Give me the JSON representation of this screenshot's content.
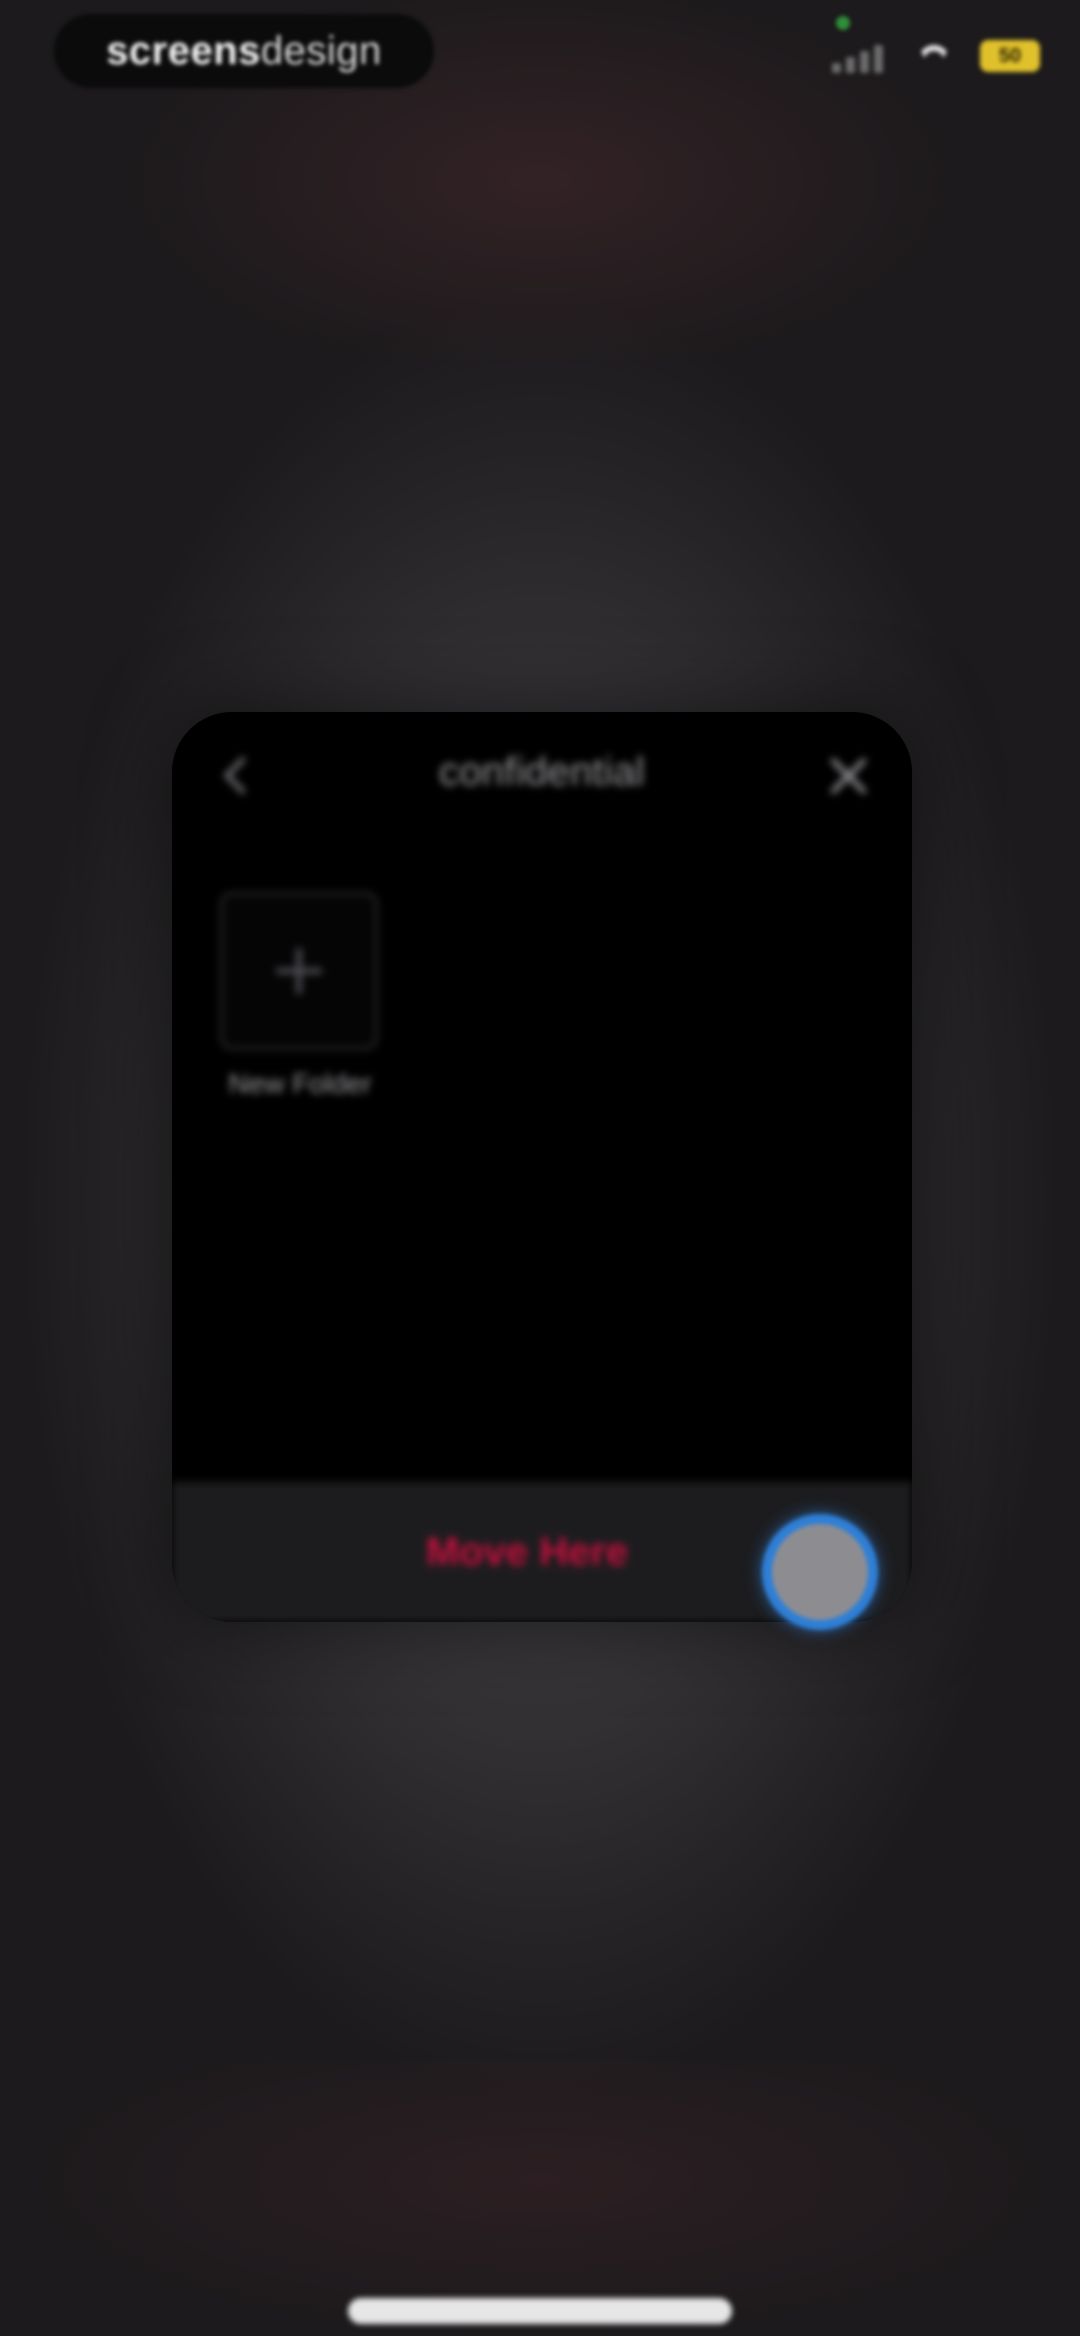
{
  "status_bar": {
    "watermark_bold": "screens",
    "watermark_light": "design",
    "battery_level": "50"
  },
  "dialog": {
    "title": "confidential",
    "new_folder_label": "New Folder",
    "move_here_label": "Move Here"
  },
  "icons": {
    "back": "chevron-left-icon",
    "close": "close-icon",
    "new_folder": "plus-icon"
  },
  "colors": {
    "accent_red": "#c4103e",
    "touch_ring": "#2f7fd6",
    "battery": "#e0c12c"
  }
}
